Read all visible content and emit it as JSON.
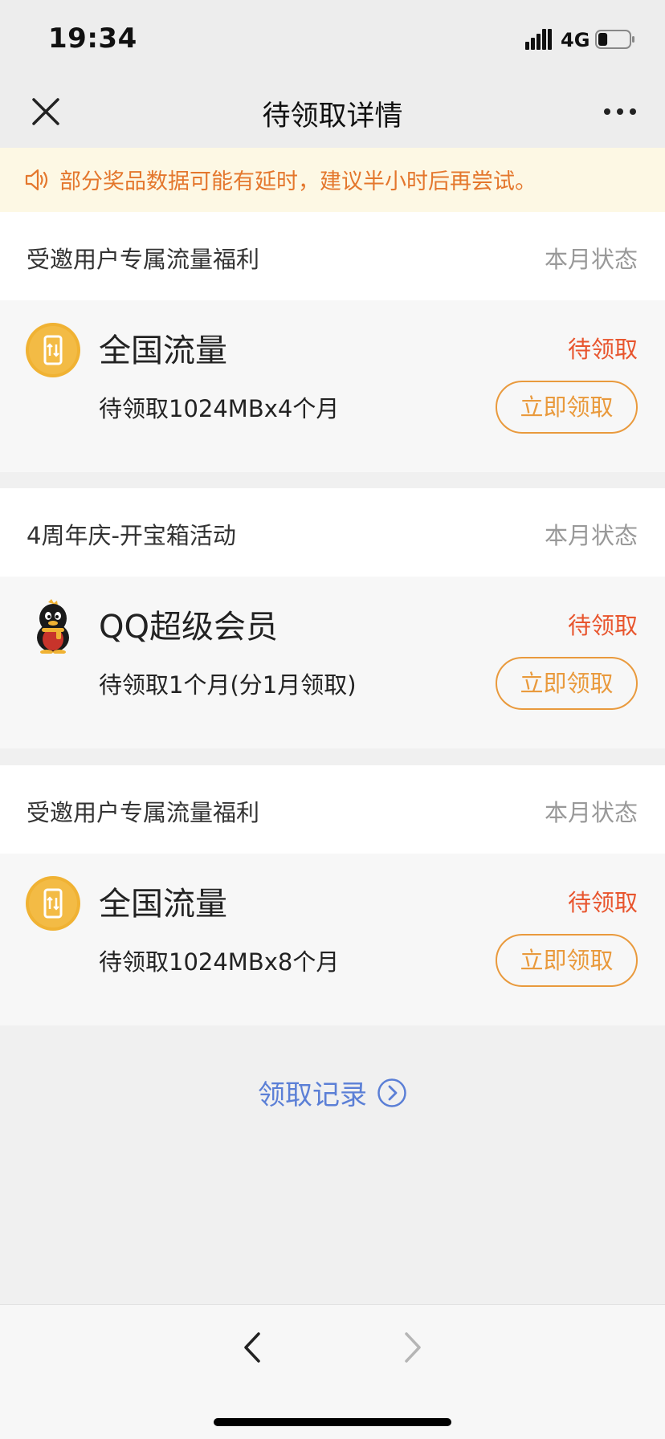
{
  "status_bar": {
    "time": "19:34",
    "network": "4G",
    "signal_icon": "signal-bars-icon",
    "battery_icon": "battery-icon",
    "battery_level": 0.3
  },
  "nav": {
    "title": "待领取详情",
    "close_icon": "close-icon",
    "more_icon": "more-dots-icon"
  },
  "notice": {
    "icon": "speaker-icon",
    "text": "部分奖品数据可能有延时，建议半小时后再尝试。"
  },
  "sections": [
    {
      "title": "受邀用户专属流量福利",
      "status_label": "本月状态",
      "item": {
        "icon": "phone-data-icon",
        "name": "全国流量",
        "state": "待领取",
        "desc": "待领取1024MBx4个月",
        "button": "立即领取"
      }
    },
    {
      "title": "4周年庆-开宝箱活动",
      "status_label": "本月状态",
      "item": {
        "icon": "qq-penguin-icon",
        "name": "QQ超级会员",
        "state": "待领取",
        "desc": "待领取1个月(分1月领取)",
        "button": "立即领取"
      }
    },
    {
      "title": "受邀用户专属流量福利",
      "status_label": "本月状态",
      "item": {
        "icon": "phone-data-icon",
        "name": "全国流量",
        "state": "待领取",
        "desc": "待领取1024MBx8个月",
        "button": "立即领取"
      }
    }
  ],
  "record_link": {
    "label": "领取记录",
    "icon": "chevron-right-circle-icon"
  },
  "toolbar": {
    "back_icon": "chevron-left-icon",
    "forward_icon": "chevron-right-icon"
  },
  "colors": {
    "accent_orange": "#e99a3d",
    "state_red": "#e8552e",
    "notice_text": "#e4772d",
    "link_blue": "#5b7fd6"
  }
}
